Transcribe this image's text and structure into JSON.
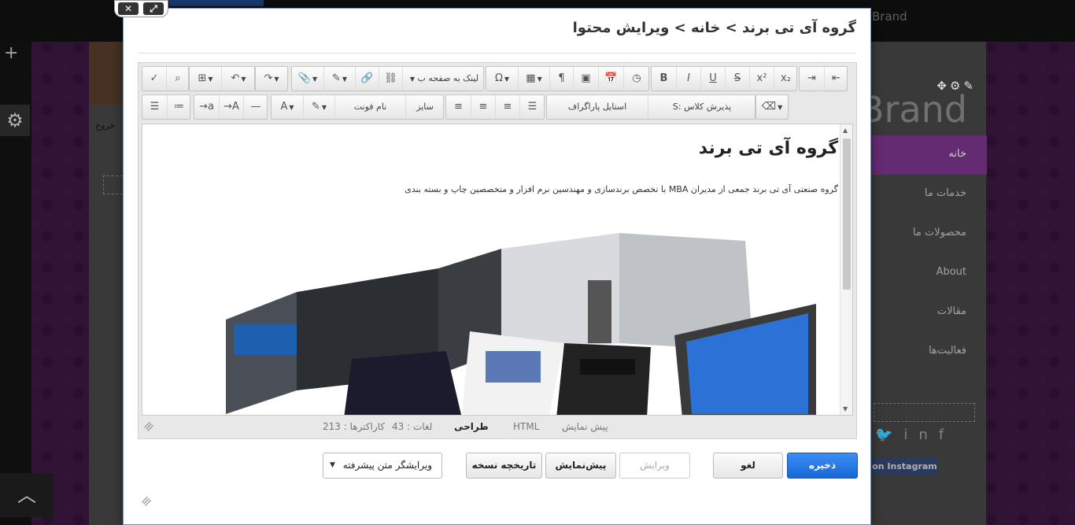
{
  "background": {
    "brand_text": "Brand",
    "logout_text": "خروج",
    "nav_items": [
      "خانه",
      "خدمات ما",
      "محصولات ما",
      "About",
      "مقالات",
      "فعالیت‌ها"
    ],
    "instagram_label": "on Instagram",
    "accent_color": "#6b2e79"
  },
  "modal": {
    "title": "گروه آی تی برند > خانه > ویرایش محتوا",
    "toolbar": {
      "link_to_page_label": "لینک به صفحه ب",
      "class_select_label": "پذیرش کلاس :S",
      "paragraph_style_label": "استایل پاراگراف",
      "font_name_label": "نام فونت",
      "font_size_label": "سایز"
    },
    "document": {
      "heading": "گروه آی تی برند",
      "paragraph": "گروه صنعتی آی تی برند جمعی از مدیران MBA با تخصص برندسازی و مهندسین نرم افزار و متخصصین چاپ و بسته بندی"
    },
    "status": {
      "preview_tab": "پیش نمایش",
      "html_tab": "HTML",
      "design_tab": "طراحی",
      "words": "لغات : 43",
      "characters": "کاراکترها : 213"
    },
    "buttons": {
      "save": "ذخیره",
      "cancel": "لغو",
      "edit": "ویرایش",
      "preview": "پیش‌نمایش",
      "history": "تاریخچه نسخه",
      "editor_mode": "ویرایشگر متن پیشرفته"
    },
    "primary_color": "#1a6fdf"
  }
}
